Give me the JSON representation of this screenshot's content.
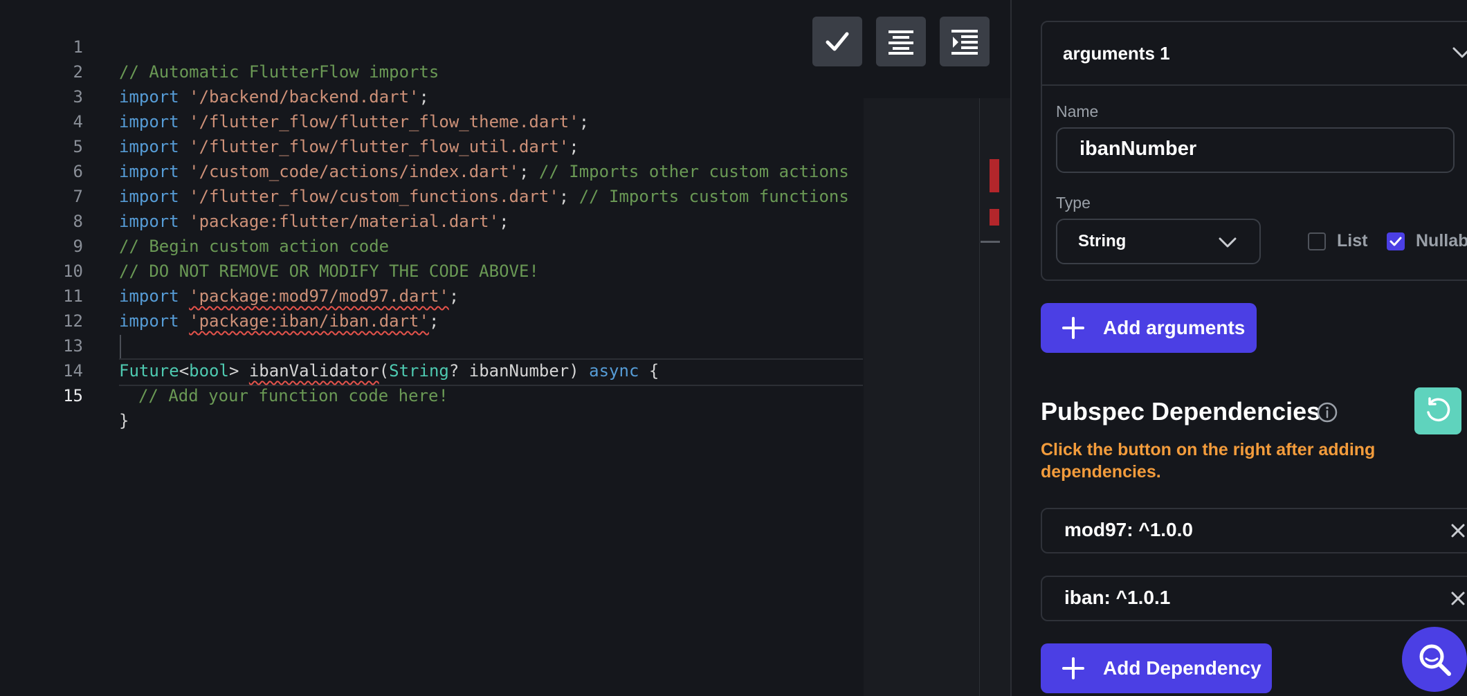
{
  "editor": {
    "line_numbers": [
      "1",
      "2",
      "3",
      "4",
      "5",
      "6",
      "7",
      "8",
      "9",
      "10",
      "11",
      "12",
      "13",
      "14",
      "15"
    ],
    "code": {
      "l1": "// Automatic FlutterFlow imports",
      "import_kw": "import",
      "l2_str": "'/backend/backend.dart'",
      "l3_str": "'/flutter_flow/flutter_flow_theme.dart'",
      "l4_str": "'/flutter_flow/flutter_flow_util.dart'",
      "l5_str": "'/custom_code/actions/index.dart'",
      "l5_cm": "// Imports other custom actions",
      "l6_str": "'/flutter_flow/custom_functions.dart'",
      "l6_cm": "// Imports custom functions",
      "l7_str": "'package:flutter/material.dart'",
      "l8": "// Begin custom action code",
      "l9": "// DO NOT REMOVE OR MODIFY THE CODE ABOVE!",
      "l10_str": "'package:mod97/mod97.dart'",
      "l11_str": "'package:iban/iban.dart'",
      "semi": ";",
      "l13_future": "Future",
      "l13_lt": "<",
      "l13_bool": "bool",
      "l13_gt": "> ",
      "l13_fn": "ibanValidator",
      "l13_paren": "(",
      "l13_string": "String",
      "l13_rest": "? ibanNumber) ",
      "l13_async": "async",
      "l13_brace": " {",
      "l14": "// Add your function code here!",
      "l15": "}"
    },
    "toolbar_icons": [
      "check-icon",
      "align-center-icon",
      "indent-icon"
    ]
  },
  "panel": {
    "arguments_title": "arguments 1",
    "name_label": "Name",
    "name_value": "ibanNumber",
    "type_label": "Type",
    "type_value": "String",
    "list_label": "List",
    "list_checked": false,
    "nullable_label": "Nullable",
    "nullable_checked": true,
    "add_arguments": "Add arguments",
    "pubspec_title": "Pubspec Dependencies",
    "pubspec_hint": "Click the button on the right after adding dependencies.",
    "dependencies": [
      "mod97: ^1.0.0",
      "iban: ^1.0.1"
    ],
    "add_dependency": "Add Dependency"
  },
  "colors": {
    "accent": "#4b3fe4",
    "warning_text": "#f39c3c",
    "refresh_button": "#5fd3bd",
    "background": "#15171c"
  }
}
